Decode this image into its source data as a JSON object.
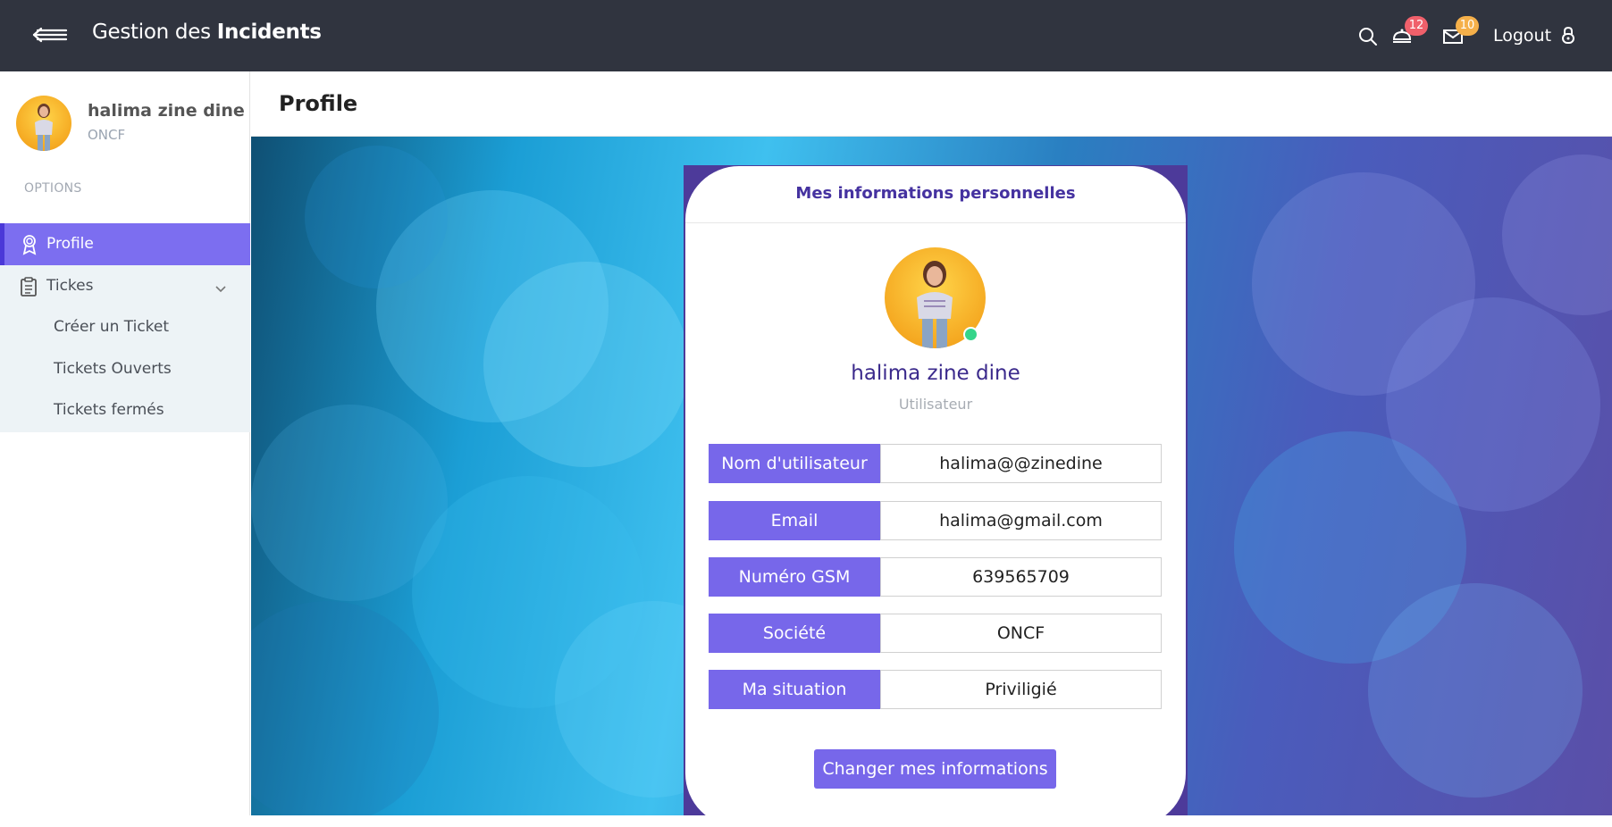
{
  "app": {
    "brand_light": "Gestion des ",
    "brand_bold": "Incidents",
    "notifications_count": "12",
    "messages_count": "10",
    "logout_label": "Logout"
  },
  "sidebar": {
    "user_name": "halima zine dine",
    "user_org": "ONCF",
    "section_label": "OPTIONS",
    "items": [
      {
        "label": "Profile",
        "icon": "award-icon",
        "active": true
      },
      {
        "label": "Tickes",
        "icon": "clipboard-icon",
        "expanded": true
      }
    ],
    "subitems": [
      "Créer un Ticket",
      "Tickets Ouverts",
      "Tickets fermés"
    ]
  },
  "main": {
    "page_title": "Profile",
    "card": {
      "title": "Mes informations personnelles",
      "name": "halima zine dine",
      "role": "Utilisateur",
      "fields": [
        {
          "label": "Nom d'utilisateur",
          "value": "halima@@zinedine"
        },
        {
          "label": "Email",
          "value": "halima@gmail.com"
        },
        {
          "label": "Numéro GSM",
          "value": "639565709"
        },
        {
          "label": "Société",
          "value": "ONCF"
        },
        {
          "label": "Ma situation",
          "value": "Priviligié"
        }
      ],
      "button_label": "Changer mes informations"
    }
  },
  "colors": {
    "topbar": "#30343f",
    "accent": "#7767ea",
    "accent_dark": "#4b38d8",
    "title_purple": "#4532a0",
    "badge_red": "#f0606b",
    "badge_orange": "#f5b04a",
    "online_green": "#35d58a"
  }
}
